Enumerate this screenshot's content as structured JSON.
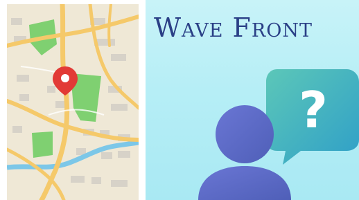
{
  "banner": {
    "title": "Wave Front",
    "icons": {
      "map": "city-map-illustration",
      "pin": "location-pin-icon",
      "person": "person-icon",
      "question": "question-speech-bubble-icon"
    },
    "colors": {
      "background": "#b6eef6",
      "title": "#2a3f86",
      "map_land": "#efe8d6",
      "map_road": "#f5c96a",
      "map_park": "#7fd071",
      "map_water": "#7cc7e8",
      "pin": "#e23a36",
      "person": "#5a68c6",
      "bubble": "#3bb2c0"
    }
  }
}
